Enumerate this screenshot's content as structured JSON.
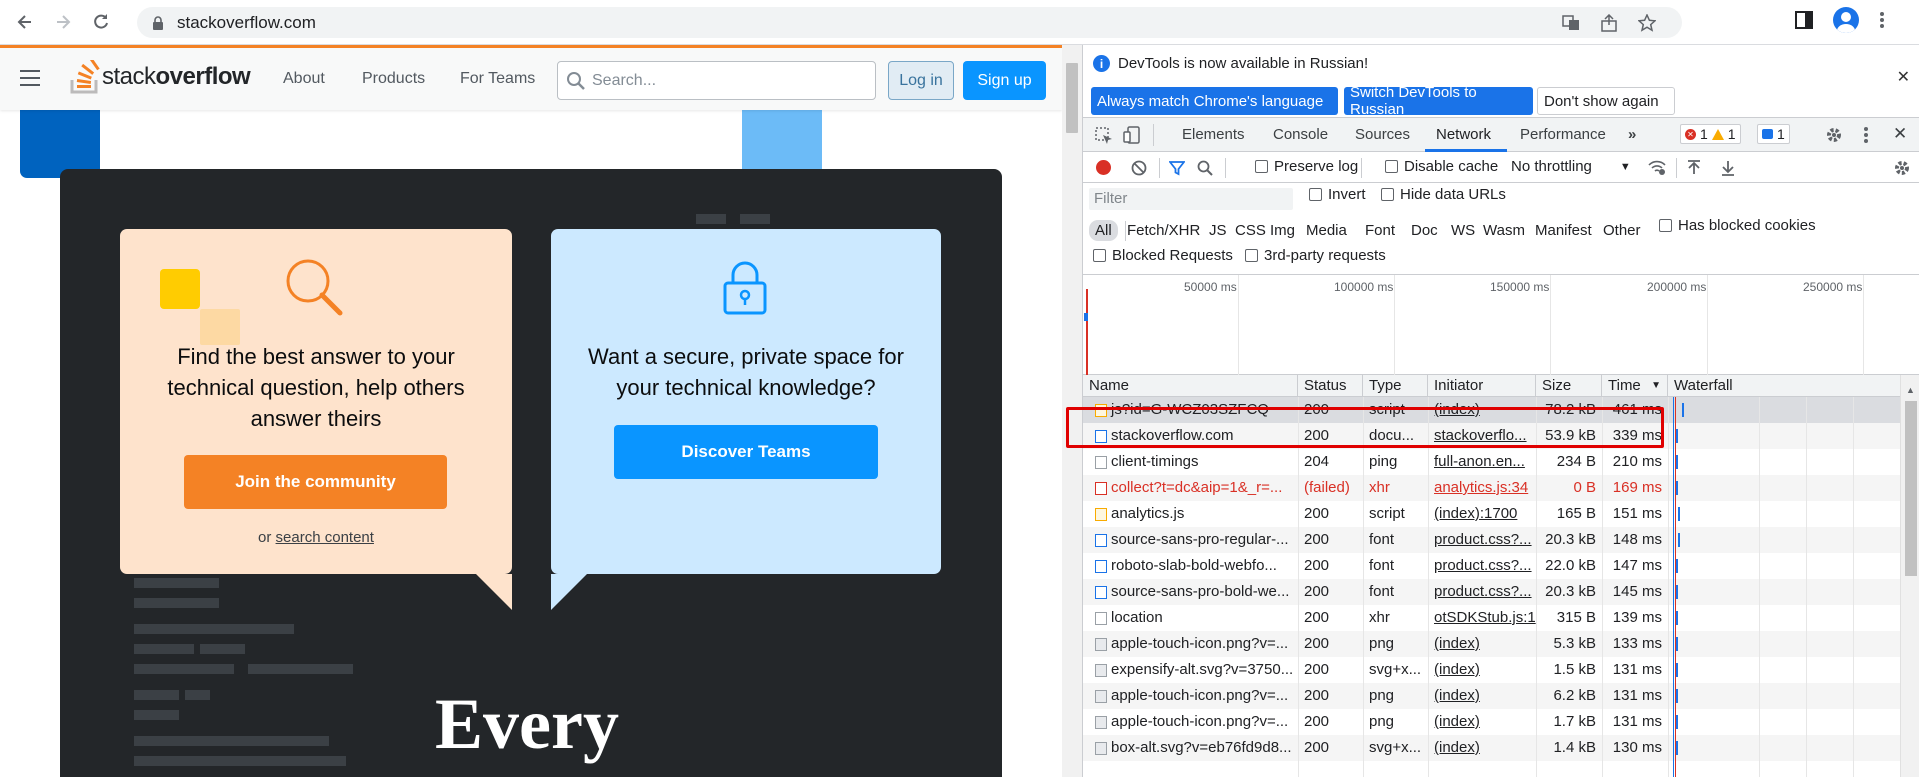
{
  "browser": {
    "url": "stackoverflow.com"
  },
  "so": {
    "logo_prefix": "stack",
    "logo_suffix": "overflow",
    "nav": [
      "About",
      "Products",
      "For Teams"
    ],
    "search_placeholder": "Search...",
    "login": "Log in",
    "signup": "Sign up",
    "card_left_text": "Find the best answer to your technical question, help others answer theirs",
    "join_button": "Join the community",
    "or_text": "or",
    "search_content": "search content",
    "card_right_text": "Want a secure, private space for your technical knowledge?",
    "teams_button": "Discover Teams",
    "hero_word": "Every"
  },
  "devtools": {
    "info_message": "DevTools is now available in Russian!",
    "btn_match": "Always match Chrome's language",
    "btn_switch": "Switch DevTools to Russian",
    "btn_dont_show": "Don't show again",
    "tabs": [
      "Elements",
      "Console",
      "Sources",
      "Network",
      "Performance"
    ],
    "active_tab": "Network",
    "error_count": "1",
    "warning_count": "1",
    "message_count": "1",
    "toolbar": {
      "preserve_log": "Preserve log",
      "disable_cache": "Disable cache",
      "throttling": "No throttling"
    },
    "filter": {
      "placeholder": "Filter",
      "invert": "Invert",
      "hide_data_urls": "Hide data URLs",
      "types": [
        "All",
        "Fetch/XHR",
        "JS",
        "CSS",
        "Img",
        "Media",
        "Font",
        "Doc",
        "WS",
        "Wasm",
        "Manifest",
        "Other"
      ],
      "has_blocked_cookies": "Has blocked cookies",
      "blocked_requests": "Blocked Requests",
      "third_party": "3rd-party requests"
    },
    "overview_ticks": [
      "50000 ms",
      "100000 ms",
      "150000 ms",
      "200000 ms",
      "250000 ms"
    ],
    "columns": [
      "Name",
      "Status",
      "Type",
      "Initiator",
      "Size",
      "Time",
      "Waterfall"
    ],
    "rows": [
      {
        "name": "js?id=G-WCZ03SZFCQ",
        "status": "200",
        "type": "script",
        "initiator": "(index)",
        "size": "78.2 kB",
        "time": "461 ms",
        "icon": "js-icon"
      },
      {
        "name": "stackoverflow.com",
        "status": "200",
        "type": "docu...",
        "initiator": "stackoverflo...",
        "size": "53.9 kB",
        "time": "339 ms",
        "icon": "document-icon"
      },
      {
        "name": "client-timings",
        "status": "204",
        "type": "ping",
        "initiator": "full-anon.en...",
        "size": "234 B",
        "time": "210 ms",
        "icon": "file-icon"
      },
      {
        "name": "collect?t=dc&aip=1&_r=...",
        "status": "(failed)",
        "type": "xhr",
        "initiator": "analytics.js:34",
        "size": "0 B",
        "time": "169 ms",
        "icon": "error-file-icon"
      },
      {
        "name": "analytics.js",
        "status": "200",
        "type": "script",
        "initiator": "(index):1700",
        "size": "165 B",
        "time": "151 ms",
        "icon": "js-icon"
      },
      {
        "name": "source-sans-pro-regular-...",
        "status": "200",
        "type": "font",
        "initiator": "product.css?...",
        "size": "20.3 kB",
        "time": "148 ms",
        "icon": "font-icon"
      },
      {
        "name": "roboto-slab-bold-webfo...",
        "status": "200",
        "type": "font",
        "initiator": "product.css?...",
        "size": "22.0 kB",
        "time": "147 ms",
        "icon": "font-icon"
      },
      {
        "name": "source-sans-pro-bold-we...",
        "status": "200",
        "type": "font",
        "initiator": "product.css?...",
        "size": "20.3 kB",
        "time": "145 ms",
        "icon": "font-icon"
      },
      {
        "name": "location",
        "status": "200",
        "type": "xhr",
        "initiator": "otSDKStub.js:1",
        "size": "315 B",
        "time": "139 ms",
        "icon": "file-icon"
      },
      {
        "name": "apple-touch-icon.png?v=...",
        "status": "200",
        "type": "png",
        "initiator": "(index)",
        "size": "5.3 kB",
        "time": "133 ms",
        "icon": "image-icon"
      },
      {
        "name": "expensify-alt.svg?v=3750...",
        "status": "200",
        "type": "svg+x...",
        "initiator": "(index)",
        "size": "1.5 kB",
        "time": "131 ms",
        "icon": "image-icon"
      },
      {
        "name": "apple-touch-icon.png?v=...",
        "status": "200",
        "type": "png",
        "initiator": "(index)",
        "size": "6.2 kB",
        "time": "131 ms",
        "icon": "image-icon"
      },
      {
        "name": "apple-touch-icon.png?v=...",
        "status": "200",
        "type": "png",
        "initiator": "(index)",
        "size": "1.7 kB",
        "time": "131 ms",
        "icon": "image-icon"
      },
      {
        "name": "box-alt.svg?v=eb76fd9d8...",
        "status": "200",
        "type": "svg+x...",
        "initiator": "(index)",
        "size": "1.4 kB",
        "time": "130 ms",
        "icon": "image-icon"
      }
    ]
  },
  "colors": {
    "so_orange": "#f48225",
    "so_blue": "#0a95ff",
    "highlight_red": "#e00000",
    "devtools_blue": "#1a73e8"
  }
}
